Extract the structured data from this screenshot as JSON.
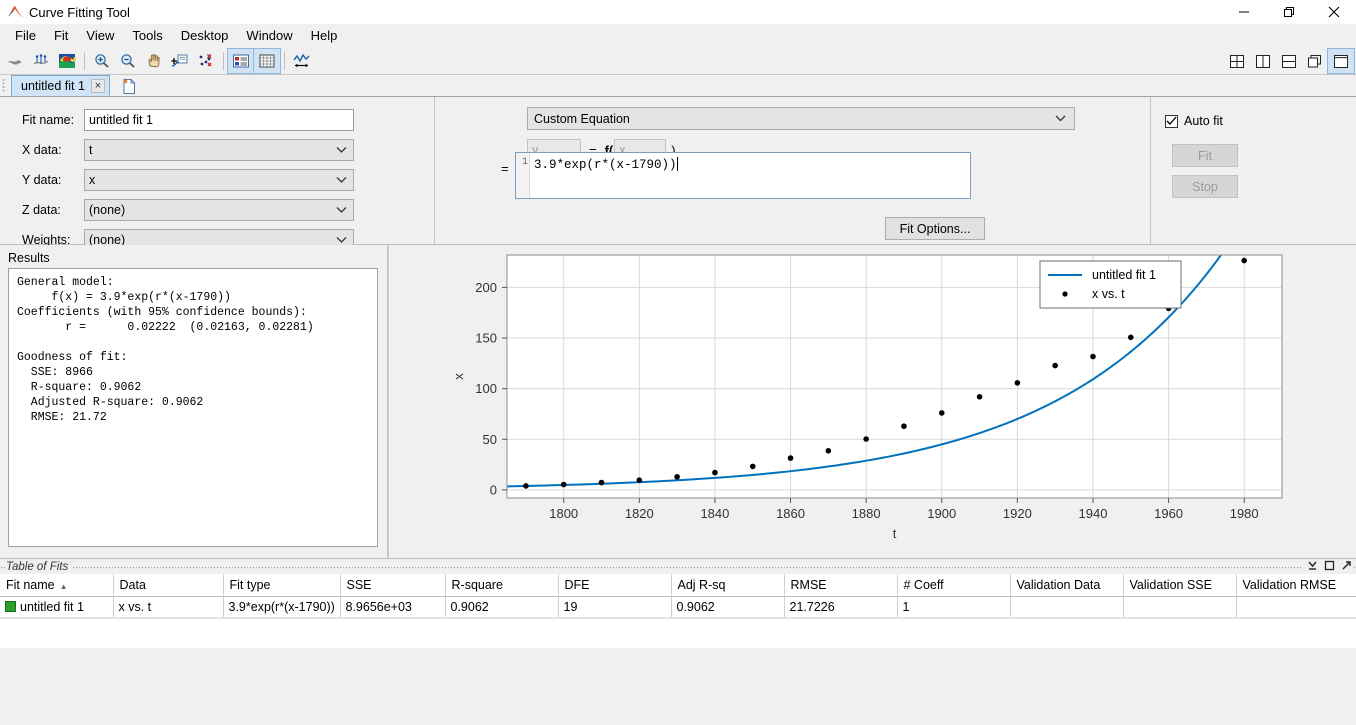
{
  "window": {
    "title": "Curve Fitting Tool",
    "app_icon": "matlab-curve-icon",
    "minimize": "minimize-icon",
    "maximize": "maximize-icon",
    "close": "close-icon"
  },
  "menu": [
    "File",
    "Fit",
    "View",
    "Tools",
    "Desktop",
    "Window",
    "Help"
  ],
  "toolbar": {
    "left_icons": [
      "fit-surface-icon",
      "data-points-icon",
      "colormap-surface-icon"
    ],
    "view_icons": [
      "zoom-in-icon",
      "zoom-out-icon",
      "pan-icon",
      "data-cursor-icon",
      "exclude-outliers-icon"
    ],
    "panel_icons": [
      "legend-toggle-icon",
      "grid-toggle-icon"
    ],
    "fit_icon": "axes-limits-icon",
    "layout_icons": [
      "tile-grid-icon",
      "tile-columns-icon",
      "tile-rows-icon",
      "cascade-icon",
      "single-pane-icon"
    ],
    "dock_icons": [
      "minimize-pane-icon",
      "undock-icon",
      "more-icon"
    ]
  },
  "tabs": {
    "items": [
      {
        "label": "untitled fit 1",
        "close": "×"
      }
    ],
    "new_tab": "new-fit-icon"
  },
  "fit_config": {
    "fit_name_label": "Fit name:",
    "fit_name_value": "untitled fit 1",
    "x_data_label": "X data:",
    "x_data_value": "t",
    "y_data_label": "Y data:",
    "y_data_value": "x",
    "z_data_label": "Z data:",
    "z_data_value": "(none)",
    "weights_label": "Weights:",
    "weights_value": "(none)"
  },
  "equation": {
    "fit_type": "Custom Equation",
    "y_placeholder": "y",
    "equals": "=",
    "f_label": "f(",
    "x_placeholder": "x",
    "close_paren": ")",
    "equals2": "=",
    "line_number": "1",
    "expression": "3.9*exp(r*(x-1790))",
    "fit_options_button": "Fit Options..."
  },
  "controls": {
    "auto_fit_label": "Auto fit",
    "auto_fit_checked": true,
    "check_glyph": "✓",
    "fit_button": "Fit",
    "stop_button": "Stop"
  },
  "results": {
    "title": "Results",
    "text": "General model:\n     f(x) = 3.9*exp(r*(x-1790))\nCoefficients (with 95% confidence bounds):\n       r =      0.02222  (0.02163, 0.02281)\n\nGoodness of fit:\n  SSE: 8966\n  R-square: 0.9062\n  Adjusted R-square: 0.9062\n  RMSE: 21.72"
  },
  "chart_data": {
    "type": "scatter",
    "title": "",
    "xlabel": "t",
    "ylabel": "x",
    "xlim": [
      1785,
      1990
    ],
    "ylim": [
      -8,
      232
    ],
    "xticks": [
      1800,
      1820,
      1840,
      1860,
      1880,
      1900,
      1920,
      1940,
      1960,
      1980
    ],
    "yticks": [
      0,
      50,
      100,
      150,
      200
    ],
    "grid": true,
    "legend_position": "top-right",
    "series": [
      {
        "name": "untitled fit 1",
        "type": "line",
        "color": "#0072bd",
        "equation": "3.9*exp(0.02222*(x-1790))",
        "x": [
          1785,
          1800,
          1820,
          1840,
          1860,
          1880,
          1900,
          1920,
          1940,
          1960,
          1975
        ],
        "values": [
          3.51,
          4.89,
          7.63,
          11.9,
          18.56,
          28.95,
          45.16,
          70.43,
          109.85,
          171.34,
          238.9
        ]
      },
      {
        "name": "x vs. t",
        "type": "scatter",
        "color": "#000000",
        "x": [
          1790,
          1800,
          1810,
          1820,
          1830,
          1840,
          1850,
          1860,
          1870,
          1880,
          1890,
          1900,
          1910,
          1920,
          1930,
          1940,
          1950,
          1960,
          1980
        ],
        "values": [
          3.9,
          5.3,
          7.2,
          9.6,
          12.9,
          17.1,
          23.2,
          31.4,
          38.6,
          50.2,
          62.9,
          76.0,
          92.0,
          105.7,
          122.8,
          131.7,
          150.7,
          179.3,
          226.5
        ]
      }
    ]
  },
  "table_of_fits": {
    "title": "Table of Fits",
    "controls": [
      "minimize-icon",
      "maximize-icon",
      "undock-icon"
    ],
    "columns": [
      "Fit name",
      "Data",
      "Fit type",
      "SSE",
      "R-square",
      "DFE",
      "Adj R-sq",
      "RMSE",
      "# Coeff",
      "Validation Data",
      "Validation SSE",
      "Validation RMSE"
    ],
    "sort_column": "Fit name",
    "sort_arrow": "▲",
    "rows": [
      {
        "fit_name": "untitled fit 1",
        "swatch_color": "#2ca02c",
        "data": "x vs. t",
        "fit_type": "3.9*exp(r*(x-1790))",
        "sse": "8.9656e+03",
        "r_square": "0.9062",
        "dfe": "19",
        "adj_r_sq": "0.9062",
        "rmse": "21.7226",
        "num_coeff": "1",
        "validation_data": "",
        "validation_sse": "",
        "validation_rmse": ""
      }
    ]
  }
}
